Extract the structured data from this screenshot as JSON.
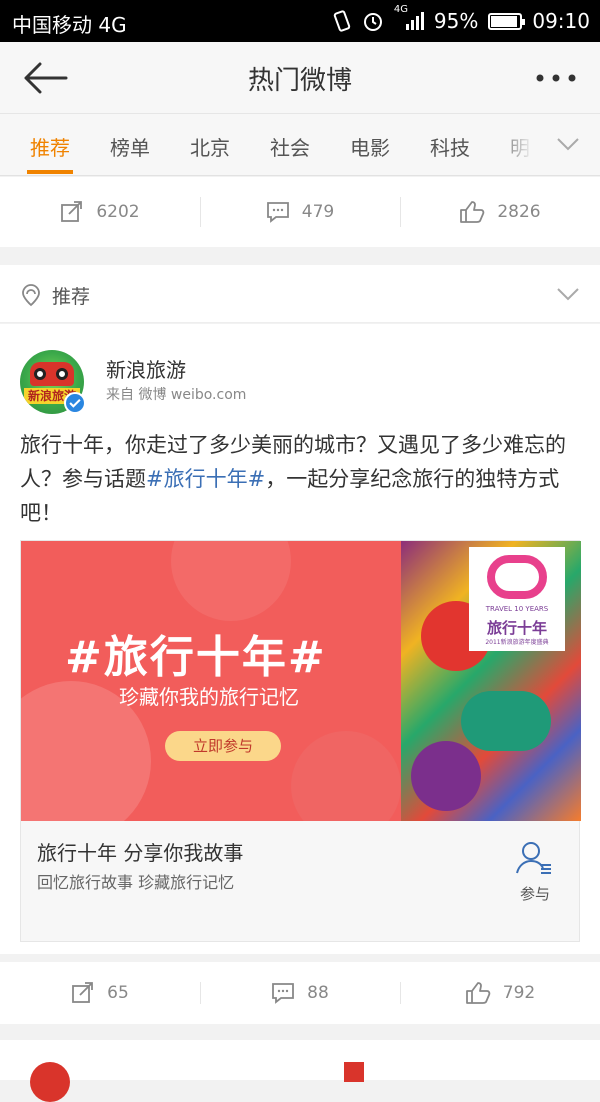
{
  "status_bar": {
    "carrier": "中国移动 4G",
    "battery": "95%",
    "time": "09:10",
    "network_badge": "4G"
  },
  "nav": {
    "title": "热门微博",
    "back_icon": "back-arrow-icon",
    "more_icon": "more-dots-icon"
  },
  "tabs": [
    {
      "label": "推荐",
      "active": true
    },
    {
      "label": "榜单",
      "active": false
    },
    {
      "label": "北京",
      "active": false
    },
    {
      "label": "社会",
      "active": false
    },
    {
      "label": "电影",
      "active": false
    },
    {
      "label": "科技",
      "active": false
    },
    {
      "label": "明",
      "active": false
    }
  ],
  "prev_actions": {
    "repost": "6202",
    "comment": "479",
    "like": "2826"
  },
  "section": {
    "label": "推荐"
  },
  "post": {
    "author": "新浪旅游",
    "source": "来自 微博 weibo.com",
    "text_before": "旅行十年，你走过了多少美丽的城市？又遇见了多少难忘的人？参与话题",
    "hashtag": "#旅行十年#",
    "text_after": "，一起分享纪念旅行的独特方式吧！",
    "avatar_text": "新浪旅游",
    "banner": {
      "headline": "#旅行十年#",
      "subline": "珍藏你我的旅行记忆",
      "cta": "立即参与",
      "logo_line1": "TRAVEL 10 YEARS",
      "logo_line2": "旅行十年",
      "logo_line3": "2011新浪旅游年度盛典"
    },
    "media_title": "旅行十年 分享你我故事",
    "media_subtitle": "回忆旅行故事 珍藏旅行记忆",
    "join_label": "参与",
    "actions": {
      "repost": "65",
      "comment": "88",
      "like": "792"
    }
  },
  "colors": {
    "accent": "#f08300",
    "link": "#3b6fb5",
    "verified": "#2a86e0"
  }
}
